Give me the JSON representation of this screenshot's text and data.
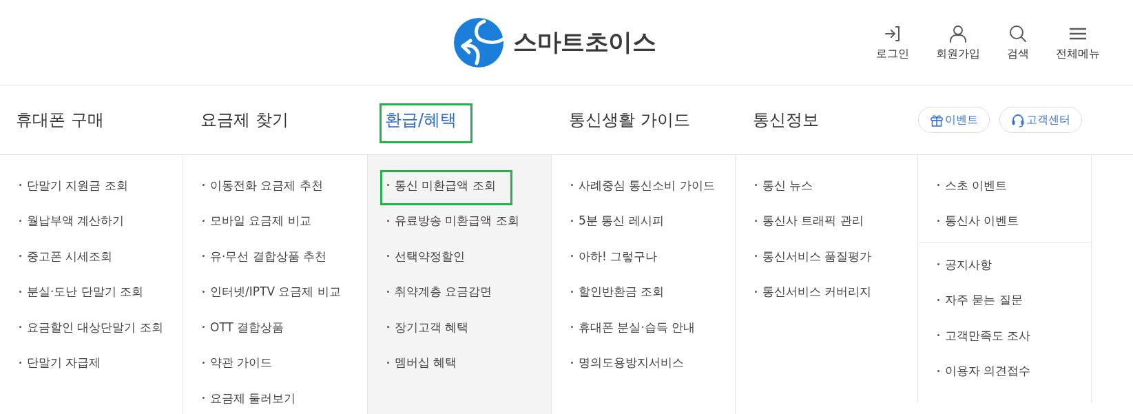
{
  "logo": {
    "text": "스마트초이스"
  },
  "header_actions": [
    "로그인",
    "회원가입",
    "검색",
    "전체메뉴"
  ],
  "nav": [
    {
      "label": "휴대폰 구매",
      "selected": false,
      "highlighted": false,
      "links": [
        {
          "label": "단말기 지원금 조회",
          "highlighted": false
        },
        {
          "label": "월납부액 계산하기",
          "highlighted": false
        },
        {
          "label": "중고폰 시세조회",
          "highlighted": false
        },
        {
          "label": "분실·도난 단말기 조회",
          "highlighted": false
        },
        {
          "label": "요금할인 대상단말기 조회",
          "highlighted": false
        },
        {
          "label": "단말기 자급제",
          "highlighted": false
        }
      ]
    },
    {
      "label": "요금제 찾기",
      "selected": false,
      "highlighted": false,
      "links": [
        {
          "label": "이동전화 요금제 추천",
          "highlighted": false
        },
        {
          "label": "모바일 요금제 비교",
          "highlighted": false
        },
        {
          "label": "유·무선 결합상품 추천",
          "highlighted": false
        },
        {
          "label": "인터넷/IPTV 요금제 비교",
          "highlighted": false
        },
        {
          "label": "OTT 결합상품",
          "highlighted": false
        },
        {
          "label": "약관 가이드",
          "highlighted": false
        },
        {
          "label": "요금제 둘러보기",
          "highlighted": false
        }
      ]
    },
    {
      "label": "환급/혜택",
      "selected": true,
      "highlighted": true,
      "links": [
        {
          "label": "통신 미환급액 조회",
          "highlighted": true
        },
        {
          "label": "유료방송 미환급액 조회",
          "highlighted": false
        },
        {
          "label": "선택약정할인",
          "highlighted": false
        },
        {
          "label": "취약계층 요금감면",
          "highlighted": false
        },
        {
          "label": "장기고객 혜택",
          "highlighted": false
        },
        {
          "label": "멤버십 혜택",
          "highlighted": false
        }
      ]
    },
    {
      "label": "통신생활 가이드",
      "selected": false,
      "highlighted": false,
      "links": [
        {
          "label": "사례중심 통신소비 가이드",
          "highlighted": false
        },
        {
          "label": "5분 통신 레시피",
          "highlighted": false
        },
        {
          "label": "아하! 그렇구나",
          "highlighted": false
        },
        {
          "label": "할인반환금 조회",
          "highlighted": false
        },
        {
          "label": "휴대폰 분실·습득 안내",
          "highlighted": false
        },
        {
          "label": "명의도용방지서비스",
          "highlighted": false
        }
      ]
    },
    {
      "label": "통신정보",
      "selected": false,
      "highlighted": false,
      "links": [
        {
          "label": "통신 뉴스",
          "highlighted": false
        },
        {
          "label": "통신사 트래픽 관리",
          "highlighted": false
        },
        {
          "label": "통신서비스 품질평가",
          "highlighted": false
        },
        {
          "label": "통신서비스 커버리지",
          "highlighted": false
        }
      ]
    }
  ],
  "quick_buttons": [
    "이벤트",
    "고객센터"
  ],
  "extra_menu": {
    "groups": [
      {
        "links": [
          {
            "label": "스초 이벤트",
            "highlighted": false
          },
          {
            "label": "통신사 이벤트",
            "highlighted": false
          }
        ]
      },
      {
        "links": [
          {
            "label": "공지사항",
            "highlighted": false
          },
          {
            "label": "자주 묻는 질문",
            "highlighted": false
          },
          {
            "label": "고객만족도 조사",
            "highlighted": false
          },
          {
            "label": "이용자 의견접수",
            "highlighted": false
          }
        ]
      }
    ]
  }
}
